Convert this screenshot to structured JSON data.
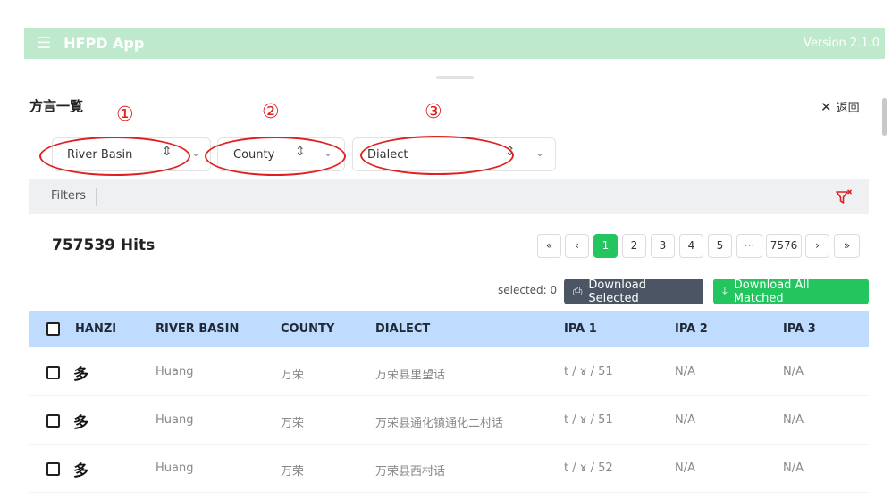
{
  "app": {
    "menu_icon": "hamburger-icon",
    "title": "HFPD App",
    "version": "Version 2.1.0",
    "bar_color": "#bfe9cc"
  },
  "page": {
    "heading": "方言一覧",
    "back_label": "返回"
  },
  "annotations": [
    "①",
    "②",
    "③"
  ],
  "selects": {
    "river_basin": "River Basin",
    "county": "County",
    "dialect": "Dialect"
  },
  "filters": {
    "label": "Filters",
    "clear_icon": "filter-clear-icon"
  },
  "results": {
    "hits": "757539 Hits"
  },
  "pagination": {
    "first": "«",
    "prev": "‹",
    "pages": [
      "1",
      "2",
      "3",
      "4",
      "5"
    ],
    "ellipsis": "···",
    "last_page": "7576",
    "next": "›",
    "last": "»",
    "active_page": "1"
  },
  "actions": {
    "selected": "selected: 0",
    "download_selected": "Download Selected",
    "download_all": "Download All Matched",
    "accent": "#22c55e"
  },
  "table": {
    "columns": [
      "HANZI",
      "RIVER BASIN",
      "COUNTY",
      "DIALECT",
      "IPA 1",
      "IPA 2",
      "IPA 3"
    ],
    "header_color": "#bfdbfe",
    "rows": [
      {
        "hanzi": "多",
        "river_basin": "Huang",
        "county": "万荣",
        "dialect": "万荣县里望话",
        "ipa1": "t / ɤ / 51",
        "ipa2": "N/A",
        "ipa3": "N/A"
      },
      {
        "hanzi": "多",
        "river_basin": "Huang",
        "county": "万荣",
        "dialect": "万荣县通化镇通化二村话",
        "ipa1": "t / ɤ / 51",
        "ipa2": "N/A",
        "ipa3": "N/A"
      },
      {
        "hanzi": "多",
        "river_basin": "Huang",
        "county": "万荣",
        "dialect": "万荣县西村话",
        "ipa1": "t / ɤ / 52",
        "ipa2": "N/A",
        "ipa3": "N/A"
      }
    ]
  }
}
